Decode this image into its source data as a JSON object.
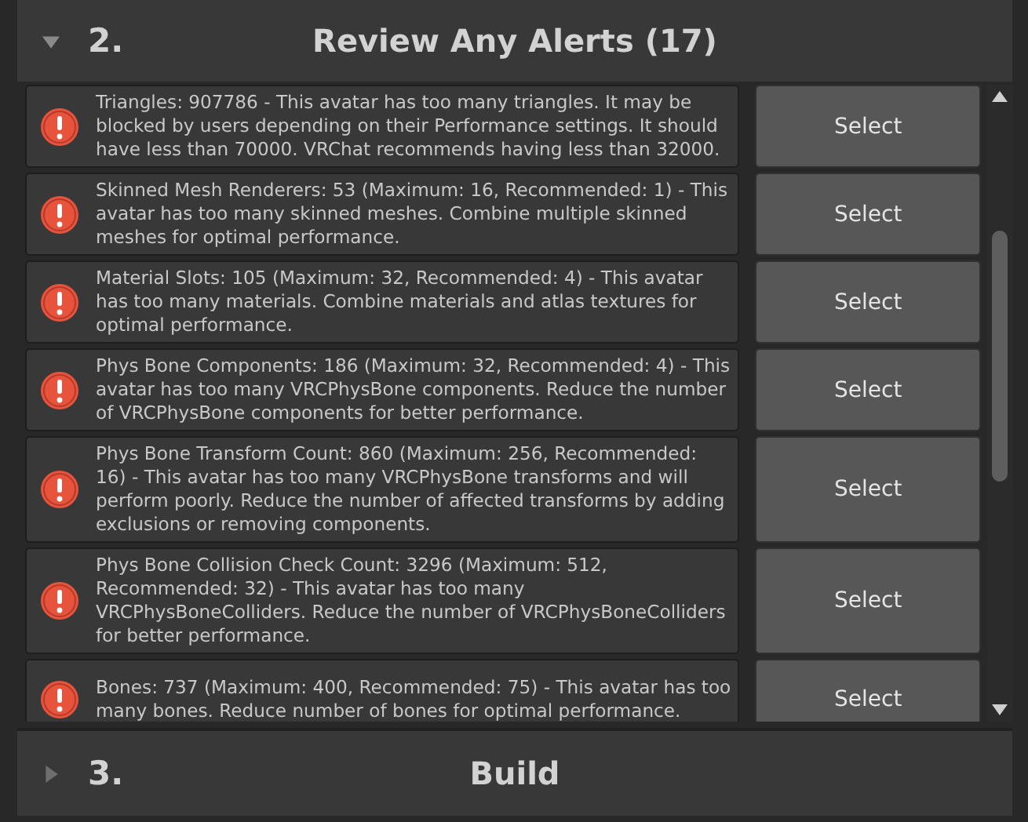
{
  "sections": [
    {
      "number": "2.",
      "title": "Review Any Alerts (17)",
      "expanded": true
    },
    {
      "number": "3.",
      "title": "Build",
      "expanded": false
    }
  ],
  "alerts": [
    {
      "message": "Triangles: 907786 - This avatar has too many triangles. It may be blocked by users depending on their Performance settings. It should have less than 70000. VRChat recommends having less than 32000.",
      "button": "Select"
    },
    {
      "message": "Skinned Mesh Renderers: 53 (Maximum: 16, Recommended: 1) - This avatar has too many skinned meshes. Combine multiple skinned meshes for optimal performance.",
      "button": "Select"
    },
    {
      "message": "Material Slots: 105 (Maximum: 32, Recommended: 4) - This avatar has too many materials. Combine materials and atlas textures for optimal performance.",
      "button": "Select"
    },
    {
      "message": "Phys Bone Components: 186 (Maximum: 32, Recommended: 4) - This avatar has too many VRCPhysBone components. Reduce the number of VRCPhysBone components for better performance.",
      "button": "Select"
    },
    {
      "message": "Phys Bone Transform Count: 860 (Maximum: 256, Recommended: 16) - This avatar has too many VRCPhysBone transforms and will perform poorly. Reduce the number of affected transforms by adding exclusions or removing components.",
      "button": "Select"
    },
    {
      "message": "Phys Bone Collision Check Count: 3296 (Maximum: 512, Recommended: 32) - This avatar has too many VRCPhysBoneColliders. Reduce the number of VRCPhysBoneColliders for better performance.",
      "button": "Select"
    },
    {
      "message": "Bones: 737 (Maximum: 400, Recommended: 75) - This avatar has too many bones. Reduce number of bones for optimal performance.",
      "button": "Select"
    }
  ]
}
